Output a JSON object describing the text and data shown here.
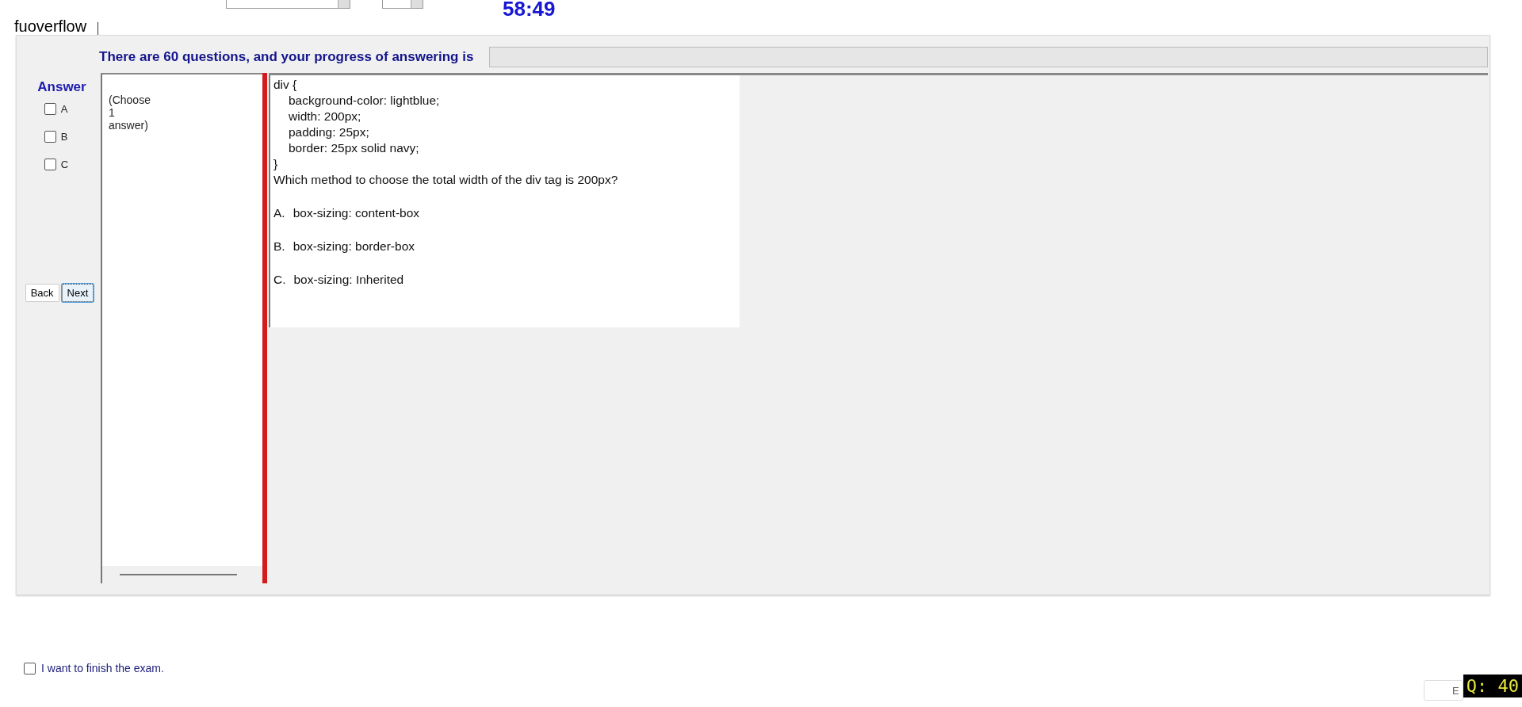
{
  "top_bar": {
    "timer": "58:49"
  },
  "app_label": "fuoverflow",
  "progress": {
    "label": "There are 60 questions, and your progress of answering is",
    "level": 0
  },
  "answer": {
    "title": "Answer",
    "options": [
      {
        "label": "A",
        "checked": false
      },
      {
        "label": "B",
        "checked": false
      },
      {
        "label": "C",
        "checked": false
      }
    ]
  },
  "nav_buttons": [
    {
      "label": "Back",
      "focused": false
    },
    {
      "label": "Next",
      "focused": true
    }
  ],
  "choose_hint": "(Choose 1 answer)",
  "question": {
    "code": {
      "opening": "div {",
      "declarations": [
        "background-color: lightblue;",
        "width: 200px;",
        "padding: 25px;",
        "border: 25px solid navy;"
      ],
      "closing": "}"
    },
    "text": "Which method to choose the total width of the div tag is 200px?",
    "options": [
      {
        "letter": "A.",
        "text": "box-sizing: content-box"
      },
      {
        "letter": "B.",
        "text": "box-sizing: border-box"
      },
      {
        "letter": "C.",
        "text": "box-sizing: Inherited"
      }
    ]
  },
  "finish": {
    "label": "I want to finish the exam.",
    "checked": false
  },
  "exit_button": "E",
  "question_counter": "Q: 40"
}
